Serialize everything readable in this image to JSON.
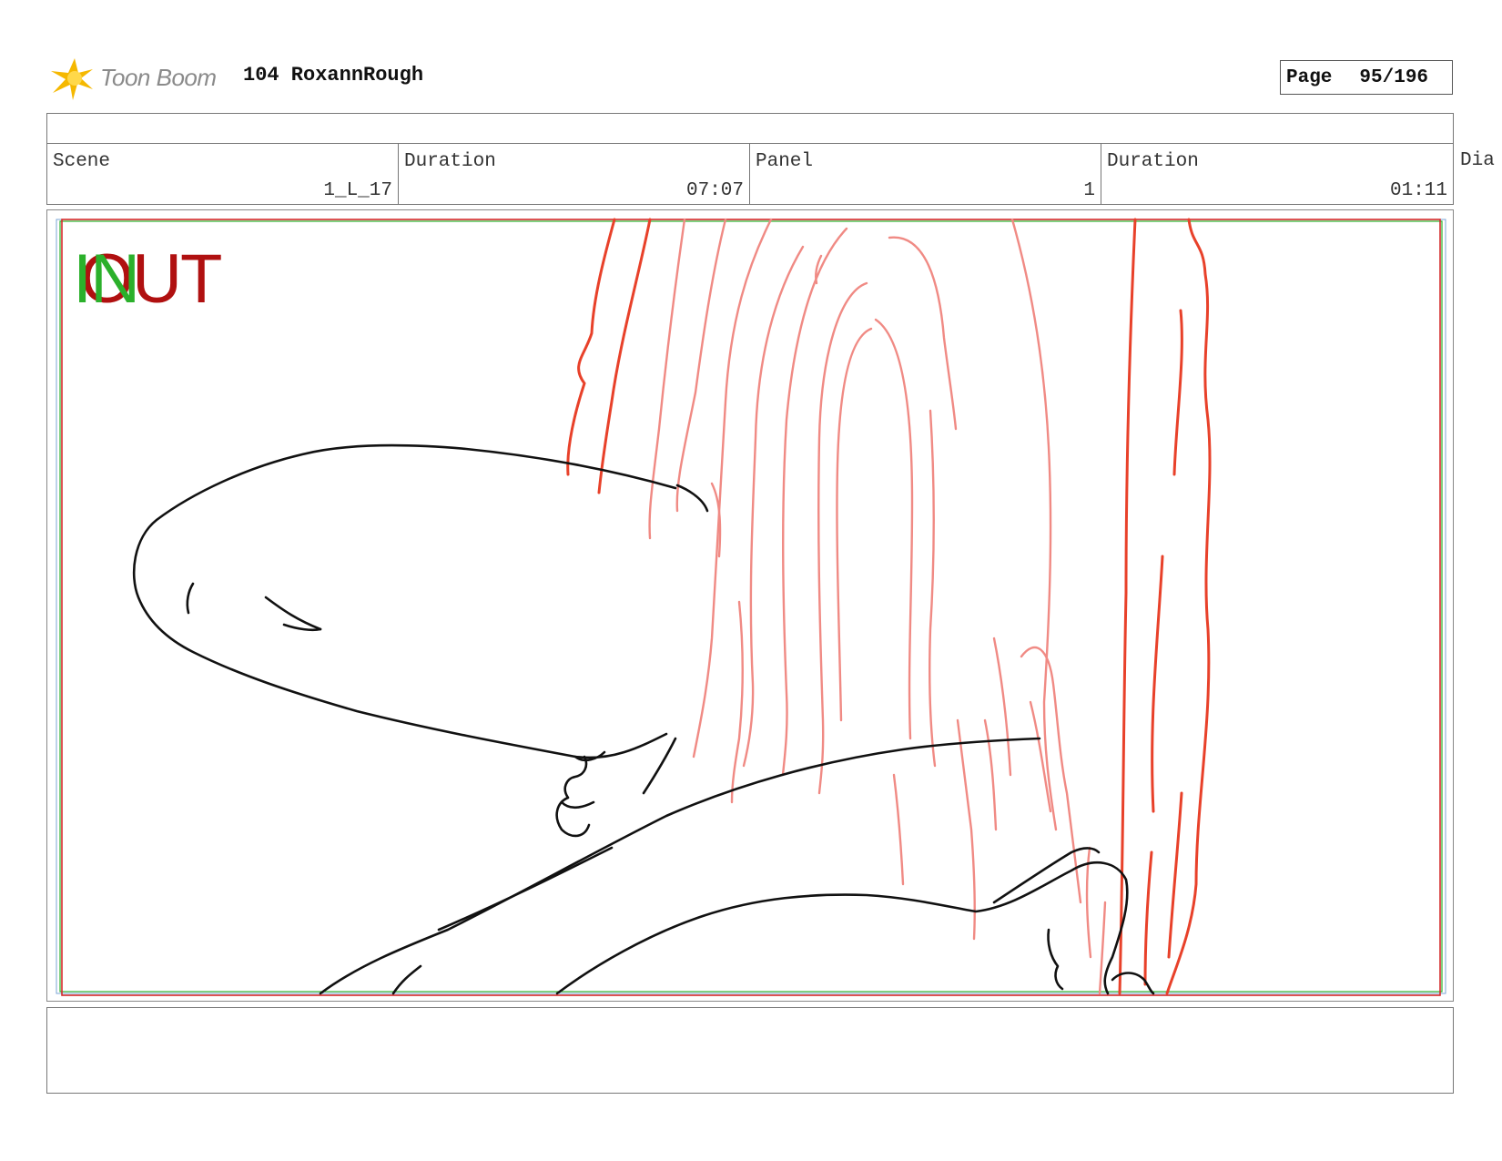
{
  "header": {
    "logo_text": "Toon Boom",
    "project_title": "104 RoxannRough",
    "page_label": "Page",
    "page_value": "95/196"
  },
  "info_row": {
    "scene_label": "Scene",
    "scene_value": "1_L_17",
    "scene_duration_label": "Duration",
    "scene_duration_value": "07:07",
    "panel_label": "Panel",
    "panel_value": "1",
    "panel_duration_label": "Duration",
    "panel_duration_value": "01:11",
    "overflow_label": "Dia"
  },
  "panel": {
    "in_marker": "IN",
    "out_marker": "OUT"
  },
  "colors": {
    "in_marker": "#2bb02b",
    "out_marker": "#b01010",
    "tree_line": "#e8412a",
    "tree_line_light": "#f08a84",
    "frame_red": "#d42a2a",
    "sketch": "#111111"
  },
  "icons": {
    "logo": "toon-boom-star-icon"
  }
}
